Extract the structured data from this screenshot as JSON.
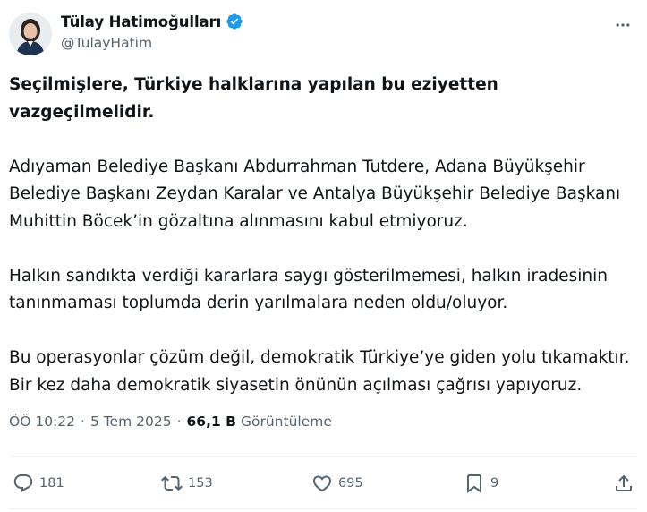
{
  "author": {
    "display_name": "Tülay Hatimoğulları",
    "handle": "@TulayHatim"
  },
  "tweet": {
    "paragraphs": [
      "Seçilmişlere, Türkiye halklarına yapılan bu eziyetten vazgeçilmelidir.",
      "Adıyaman Belediye Başkanı Abdurrahman Tutdere, Adana Büyükşehir Belediye Başkanı Zeydan Karalar ve Antalya Büyükşehir Belediye Başkanı Muhittin Böcek’in gözaltına alınmasını kabul etmiyoruz.",
      "Halkın sandıkta verdiği kararlara saygı gösterilmemesi, halkın iradesinin tanınmaması toplumda derin yarılmalara neden oldu/oluyor.",
      "Bu operasyonlar çözüm değil, demokratik Türkiye’ye giden yolu tıkamaktır. Bir kez daha demokratik siyasetin önünün açılması çağrısı yapıyoruz."
    ]
  },
  "meta": {
    "time": "ÖÖ 10:22",
    "date": "5 Tem 2025",
    "views_count": "66,1 B",
    "views_label": "Görüntüleme",
    "separator": "·"
  },
  "actions": {
    "replies": "181",
    "reposts": "153",
    "likes": "695",
    "bookmarks": "9"
  },
  "icons": {
    "verified": "verified-badge-icon",
    "more": "more-icon",
    "reply": "reply-icon",
    "repost": "repost-icon",
    "like": "heart-icon",
    "bookmark": "bookmark-icon",
    "share": "share-icon"
  },
  "colors": {
    "verified_blue": "#1d9bf0",
    "text_primary": "#0f1419",
    "text_secondary": "#536471",
    "divider": "#eff3f4"
  }
}
